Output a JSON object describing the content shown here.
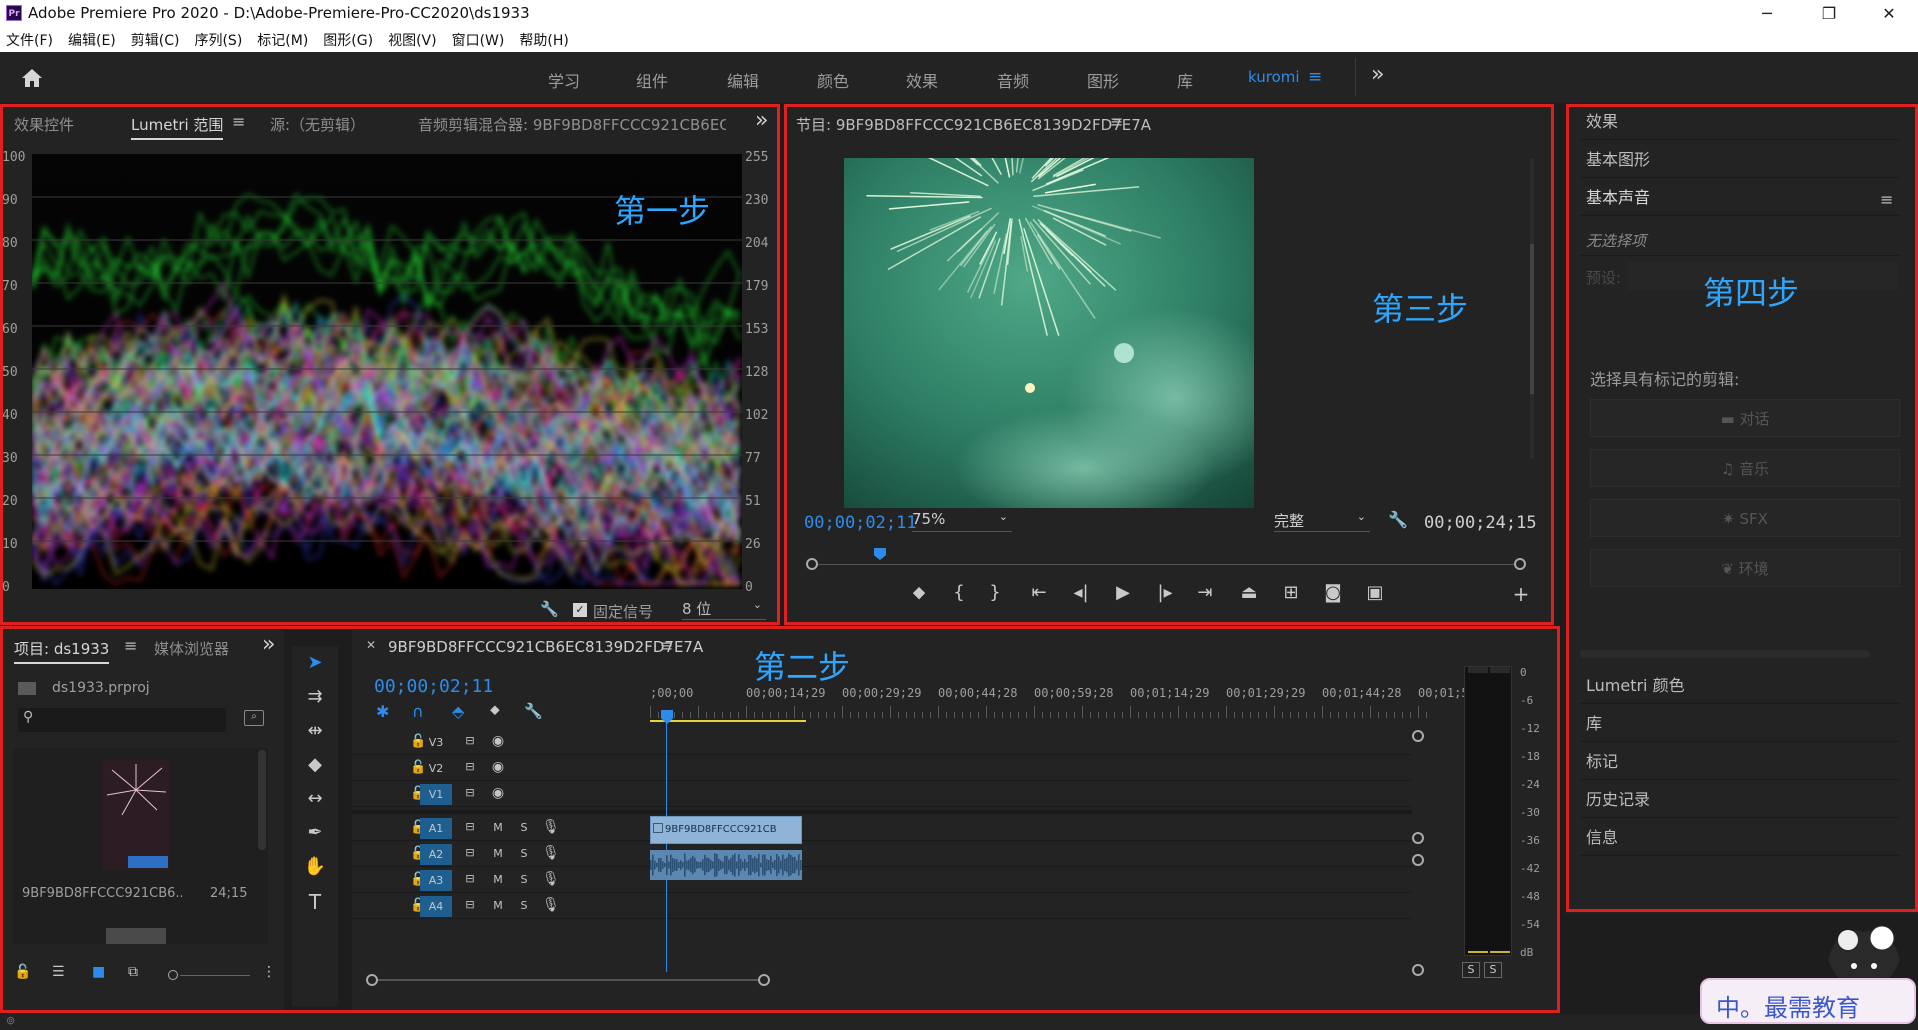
{
  "window": {
    "title": "Adobe Premiere Pro 2020 - D:\\Adobe-Premiere-Pro-CC2020\\ds1933",
    "app_icon": "Pr",
    "minimize": "─",
    "maximize": "❐",
    "close": "✕"
  },
  "menu": [
    "文件(F)",
    "编辑(E)",
    "剪辑(C)",
    "序列(S)",
    "标记(M)",
    "图形(G)",
    "视图(V)",
    "窗口(W)",
    "帮助(H)"
  ],
  "workspaces": {
    "items": [
      "学习",
      "组件",
      "编辑",
      "颜色",
      "效果",
      "音频",
      "图形",
      "库"
    ],
    "active": "kuromi",
    "more": "»"
  },
  "scope_panel": {
    "tabs": [
      "效果控件",
      "Lumetri 范围",
      "源:（无剪辑）",
      "音频剪辑混合器: 9BF9BD8FFCCC921CB6EC813"
    ],
    "active_tab": "Lumetri 范围",
    "left_scale": [
      "100",
      "90",
      "80",
      "70",
      "60",
      "50",
      "40",
      "30",
      "20",
      "10",
      "0"
    ],
    "right_scale": [
      "255",
      "230",
      "204",
      "179",
      "153",
      "128",
      "102",
      "77",
      "51",
      "26",
      "0"
    ],
    "fixed_signal": "固定信号",
    "bit_depth": "8 位",
    "step_label": "第一步"
  },
  "program_monitor": {
    "title": "节目: 9BF9BD8FFCCC921CB6EC8139D2FD7E7A",
    "current_time": "00;00;02;11",
    "zoom": "75%",
    "quality": "完整",
    "duration": "00;00;24;15",
    "playhead_fraction": 0.089,
    "step_label": "第三步"
  },
  "essential_sound": {
    "items_top": [
      "效果",
      "基本图形",
      "基本声音"
    ],
    "no_selection": "无选择项",
    "preset_label": "预设:",
    "prompt": "选择具有标记的剪辑:",
    "buttons": [
      "对话",
      "音乐",
      "SFX",
      "环境"
    ],
    "items_bottom": [
      "Lumetri 颜色",
      "库",
      "标记",
      "历史记录",
      "信息"
    ],
    "step_label": "第四步"
  },
  "project_panel": {
    "tabs": [
      "项目: ds1933",
      "媒体浏览器"
    ],
    "project_file": "ds1933.prproj",
    "search_placeholder": "",
    "clip_name": "9BF9BD8FFCCC921CB6...",
    "clip_duration": "24;15"
  },
  "timeline": {
    "sequence_name": "9BF9BD8FFCCC921CB6EC8139D2FD7E7A",
    "current_time": "00;00;02;11",
    "ruler": [
      ";00;00",
      "00;00;14;29",
      "00;00;29;29",
      "00;00;44;28",
      "00;00;59;28",
      "00;01;14;29",
      "00;01;29;29",
      "00;01;44;28",
      "00;01;5"
    ],
    "video_tracks": [
      "V3",
      "V2",
      "V1"
    ],
    "audio_tracks": [
      "A1",
      "A2",
      "A3",
      "A4"
    ],
    "clip_label": "9BF9BD8FFCCC921CB",
    "mute": "M",
    "solo": "S",
    "step_label": "第二步"
  },
  "audio_meter": {
    "scale": [
      "0",
      "-6",
      "-12",
      "-18",
      "-24",
      "-30",
      "-36",
      "-42",
      "-48",
      "-54",
      "dB"
    ],
    "solo_buttons": [
      "S",
      "S"
    ]
  },
  "watermark": {
    "text": "中。最需教育"
  },
  "colors": {
    "accent": "#2d8ceb",
    "step": "#2ea6ff",
    "highlight": "#e0201e",
    "track_active": "#1f5f8f"
  }
}
